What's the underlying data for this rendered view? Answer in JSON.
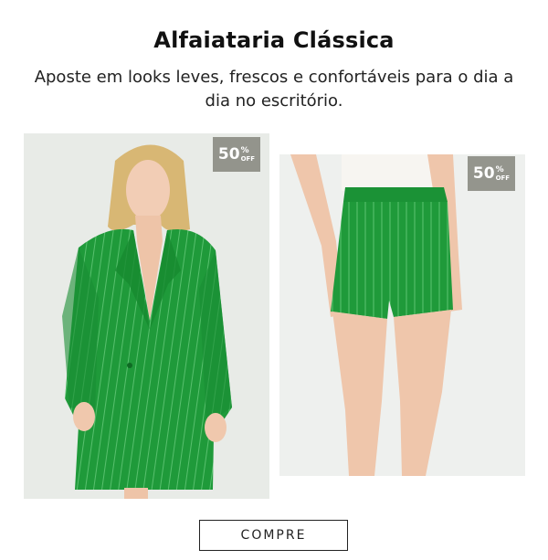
{
  "header": {
    "title": "Alfaiataria Clássica",
    "subtitle": "Aposte em looks leves, frescos e confortáveis para o dia a dia no escritório."
  },
  "products": [
    {
      "name": "blazer",
      "badge": {
        "value": "50",
        "percent": "%",
        "off": "OFF"
      }
    },
    {
      "name": "shorts",
      "badge": {
        "value": "50",
        "percent": "%",
        "off": "OFF"
      }
    }
  ],
  "cta": {
    "label": "COMPRE"
  },
  "colors": {
    "accent": "#1f9a3a",
    "badge_bg": "#80807a",
    "text": "#111111"
  }
}
